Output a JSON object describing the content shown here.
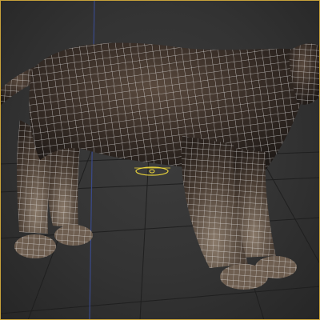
{
  "viewport": {
    "active_border_color": "#c8a23a",
    "background_color": "#353535",
    "grid_color": "#1f1f1f",
    "axis_line_color": "#3a4a8a",
    "wire_color": "#e8e8e8",
    "skin_color": "#3a2f28",
    "pivot_color": "#e8d23a",
    "icons": [
      "pivot-gizmo-icon"
    ]
  }
}
